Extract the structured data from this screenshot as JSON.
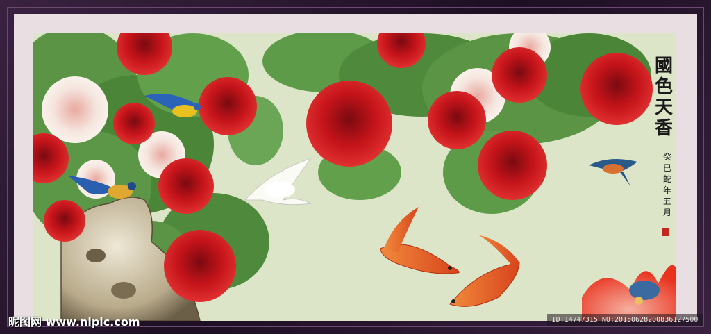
{
  "painting": {
    "title_chars": [
      "國",
      "色",
      "天",
      "香"
    ],
    "inscription_chars": [
      "癸",
      "巳",
      "蛇",
      "年",
      "五",
      "月"
    ]
  },
  "watermark": {
    "site": "昵图网 www.nipic.com",
    "id_text": "ID:14747315 NO:20150628200836127500"
  },
  "colors": {
    "background": "#dde5c8",
    "peony_red": "#c4141a",
    "leaf_green": "#4f8a3c",
    "koi_orange": "#e8642a"
  }
}
